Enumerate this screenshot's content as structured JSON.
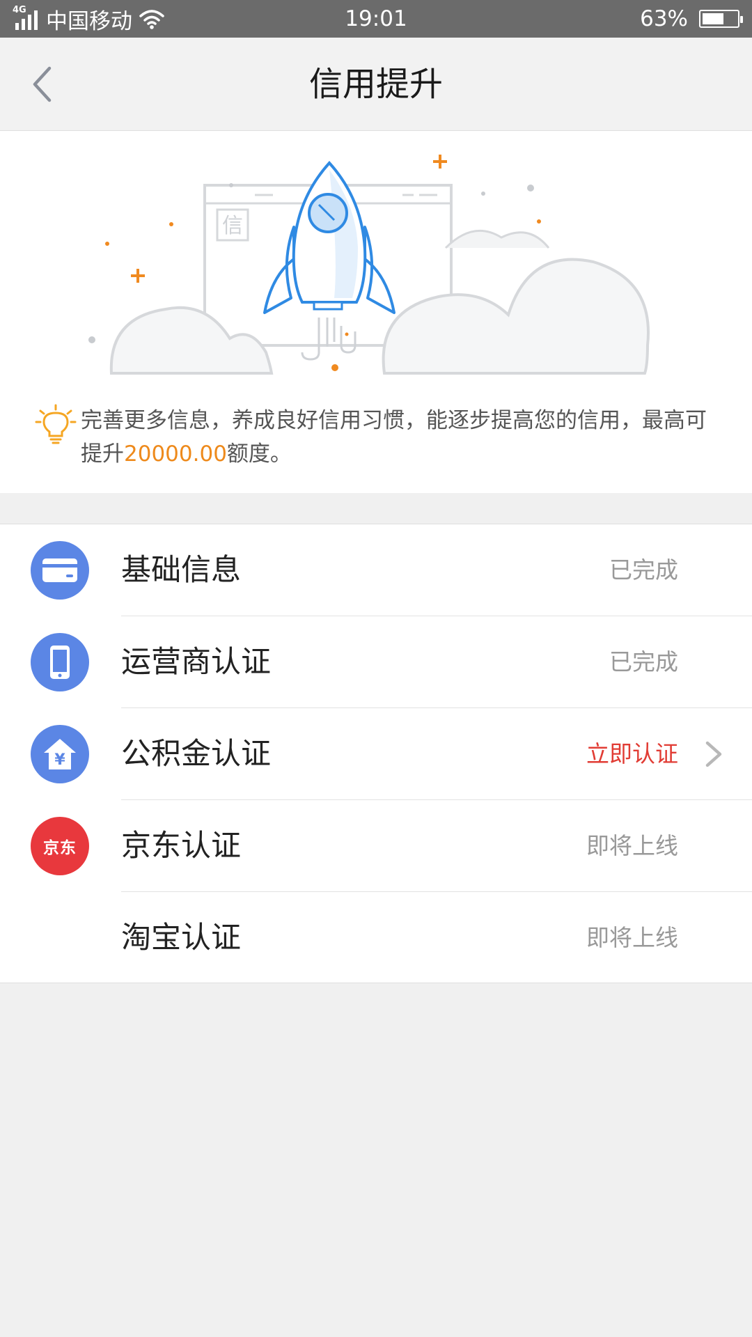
{
  "status_bar": {
    "network": "4G",
    "carrier": "中国移动",
    "time": "19:01",
    "battery_text": "63%",
    "battery_level": 0.63
  },
  "nav": {
    "title": "信用提升",
    "back_icon": "chevron-left-icon"
  },
  "hero": {
    "badge_text": "信",
    "tip_prefix": "完善更多信息，养成良好信用习惯，能逐步提高您的信用，最高可提升",
    "tip_amount": "20000.00",
    "tip_suffix": "额度。",
    "accent_color": "#ee8a1c"
  },
  "items": [
    {
      "label": "基础信息",
      "status": "已完成",
      "icon": "card-icon"
    },
    {
      "label": "运营商认证",
      "status": "已完成",
      "icon": "phone-icon"
    },
    {
      "label": "公积金认证",
      "status": "立即认证",
      "icon": "house-yuan-icon"
    },
    {
      "label": "京东认证",
      "status": "即将上线",
      "icon": "jd-logo-icon",
      "logo_text": "京东"
    },
    {
      "label": "淘宝认证",
      "status": "即将上线"
    }
  ],
  "colors": {
    "icon_blue": "#5b86e5",
    "jd_red": "#e8383d",
    "action_red": "#e13c34",
    "muted": "#999999"
  }
}
